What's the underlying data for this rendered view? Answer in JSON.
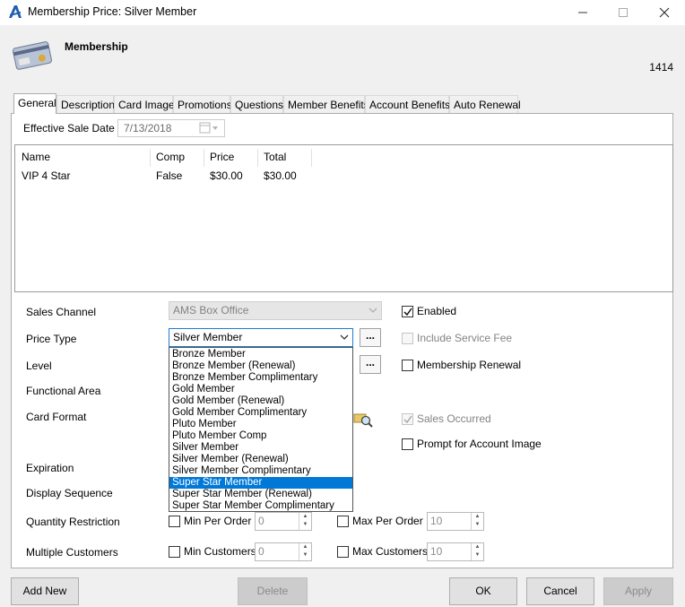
{
  "window": {
    "title": "Membership Price: Silver Member"
  },
  "header": {
    "title": "Membership",
    "id": "1414"
  },
  "tabs": [
    {
      "label": "General"
    },
    {
      "label": "Description"
    },
    {
      "label": "Card Image"
    },
    {
      "label": "Promotions"
    },
    {
      "label": "Questions"
    },
    {
      "label": "Member Benefits"
    },
    {
      "label": "Account Benefits"
    },
    {
      "label": "Auto Renewal"
    }
  ],
  "general": {
    "effective_sale_date_label": "Effective Sale Date",
    "effective_sale_date_value": "7/13/2018",
    "grid": {
      "columns": [
        "Name",
        "Comp",
        "Price",
        "Total"
      ],
      "rows": [
        [
          "VIP 4 Star",
          "False",
          "$30.00",
          "$30.00"
        ]
      ]
    },
    "labels": {
      "sales_channel": "Sales Channel",
      "price_type": "Price Type",
      "level": "Level",
      "functional_area": "Functional Area",
      "card_format": "Card Format",
      "expiration": "Expiration",
      "display_sequence": "Display Sequence",
      "quantity_restriction": "Quantity Restriction",
      "multiple_customers": "Multiple Customers"
    },
    "sales_channel_value": "AMS Box Office",
    "price_type_value": "Silver Member",
    "dots_label": "...",
    "checkboxes": {
      "enabled": "Enabled",
      "include_service_fee": "Include Service Fee",
      "membership_renewal": "Membership Renewal",
      "sales_occurred": "Sales Occurred",
      "prompt_account_image": "Prompt for Account Image"
    },
    "min_per_order": {
      "label": "Min Per Order",
      "value": "0"
    },
    "max_per_order": {
      "label": "Max Per Order",
      "value": "10"
    },
    "min_customers": {
      "label": "Min Customers",
      "value": "0"
    },
    "max_customers": {
      "label": "Max Customers",
      "value": "10"
    }
  },
  "price_type_options": [
    "Bronze Member",
    "Bronze Member (Renewal)",
    "Bronze Member Complimentary",
    "Gold Member",
    "Gold Member (Renewal)",
    "Gold Member Complimentary",
    "Pluto Member",
    "Pluto Member Comp",
    "Silver Member",
    "Silver Member (Renewal)",
    "Silver Member Complimentary",
    "Super Star Member",
    "Super Star Member (Renewal)",
    "Super Star Member Complimentary"
  ],
  "price_type_highlighted": "Super Star Member",
  "buttons": {
    "add_new": "Add New",
    "delete": "Delete",
    "ok": "OK",
    "cancel": "Cancel",
    "apply": "Apply"
  },
  "colors": {
    "selection": "#0078d7",
    "app_accent": "#1f5fae"
  }
}
